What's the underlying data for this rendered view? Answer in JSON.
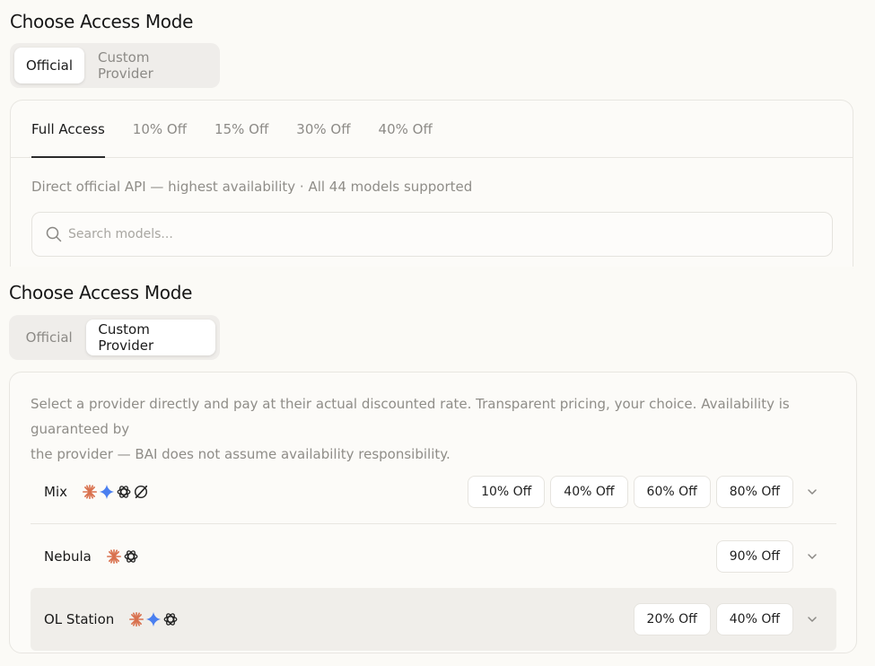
{
  "panel1": {
    "title": "Choose Access Mode",
    "segments": [
      "Official",
      "Custom Provider"
    ],
    "active_segment": "Official",
    "tabs": [
      "Full Access",
      "10% Off",
      "15% Off",
      "30% Off",
      "40% Off"
    ],
    "active_tab": "Full Access",
    "description": "Direct official API — highest availability · All 44 models supported",
    "search": {
      "placeholder": "Search models...",
      "value": ""
    }
  },
  "panel2": {
    "title": "Choose Access Mode",
    "segments": [
      "Official",
      "Custom Provider"
    ],
    "active_segment": "Custom Provider",
    "description_line1": "Select a provider directly and pay at their actual discounted rate. Transparent pricing, your choice. Availability is guaranteed by",
    "description_line2": "the provider — BAI does not assume availability responsibility.",
    "providers": [
      {
        "name": "Mix",
        "logos": [
          "claude-starburst-icon",
          "gemini-sparkle-icon",
          "openai-knot-icon",
          "grok-slash-icon"
        ],
        "discounts": [
          "10% Off",
          "40% Off",
          "60% Off",
          "80% Off"
        ]
      },
      {
        "name": "Nebula",
        "logos": [
          "claude-starburst-icon",
          "openai-knot-icon"
        ],
        "discounts": [
          "90% Off"
        ]
      },
      {
        "name": "OL Station",
        "logos": [
          "claude-starburst-icon",
          "gemini-sparkle-icon",
          "openai-knot-icon"
        ],
        "discounts": [
          "20% Off",
          "40% Off"
        ]
      }
    ]
  },
  "colors": {
    "background": "#fbfaf6",
    "claude_orange": "#d9714e",
    "gemini_blue": "#4a7ff0",
    "text_muted": "#8f8d88"
  }
}
